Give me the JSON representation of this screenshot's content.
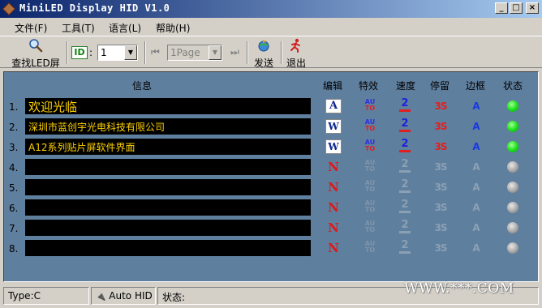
{
  "window": {
    "title": "MiniLED Display HID V1.0",
    "controls": {
      "minimize": "_",
      "maximize": "□",
      "close": "×"
    }
  },
  "menu": [
    "文件(F)",
    "工具(T)",
    "语言(L)",
    "帮助(H)"
  ],
  "toolbar": {
    "find_led_label": "查找LED屏",
    "id_label": "ID",
    "id_colon": ":",
    "id_value": "1",
    "page_value": "1Page",
    "send_label": "发送",
    "exit_label": "退出"
  },
  "columns": {
    "info": "信息",
    "edit": "编辑",
    "effect": "特效",
    "speed": "速度",
    "stay": "停留",
    "frame": "边框",
    "status": "状态"
  },
  "rows": [
    {
      "num": "1.",
      "text": "欢迎光临",
      "edit": "A",
      "effect_top": "AU",
      "effect_bottom": "TO",
      "speed": "2",
      "stay": "3S",
      "frame": "A",
      "active": true
    },
    {
      "num": "2.",
      "text": "深圳市蓝创宇光电科技有限公司",
      "edit": "W",
      "effect_top": "AU",
      "effect_bottom": "TO",
      "speed": "2",
      "stay": "3S",
      "frame": "A",
      "active": true
    },
    {
      "num": "3.",
      "text": "A12系列贴片屏软件界面",
      "edit": "W",
      "effect_top": "AU",
      "effect_bottom": "TO",
      "speed": "2",
      "stay": "3S",
      "frame": "A",
      "active": true
    },
    {
      "num": "4.",
      "text": "",
      "edit": "N",
      "effect_top": "AU",
      "effect_bottom": "TO",
      "speed": "2",
      "stay": "3S",
      "frame": "A",
      "active": false
    },
    {
      "num": "5.",
      "text": "",
      "edit": "N",
      "effect_top": "AU",
      "effect_bottom": "TO",
      "speed": "2",
      "stay": "3S",
      "frame": "A",
      "active": false
    },
    {
      "num": "6.",
      "text": "",
      "edit": "N",
      "effect_top": "AU",
      "effect_bottom": "TO",
      "speed": "2",
      "stay": "3S",
      "frame": "A",
      "active": false
    },
    {
      "num": "7.",
      "text": "",
      "edit": "N",
      "effect_top": "AU",
      "effect_bottom": "TO",
      "speed": "2",
      "stay": "3S",
      "frame": "A",
      "active": false
    },
    {
      "num": "8.",
      "text": "",
      "edit": "N",
      "effect_top": "AU",
      "effect_bottom": "TO",
      "speed": "2",
      "stay": "3S",
      "frame": "A",
      "active": false
    }
  ],
  "statusbar": {
    "type": "Type:C",
    "mode": "Auto HID",
    "status_label": "状态:"
  },
  "watermark": "WWW.***.COM",
  "colors": {
    "panel_bg": "#5f7f9f",
    "message_text": "#ffd200",
    "status_on": "#18e018",
    "status_off": "#a8a8a8",
    "edit_new": "#e01818"
  },
  "icons": {
    "find_led": "magnifier-icon",
    "send": "send-globe-icon",
    "exit": "exit-runner-icon",
    "prev_page": "prev-page-icon",
    "next_page": "next-page-icon"
  }
}
